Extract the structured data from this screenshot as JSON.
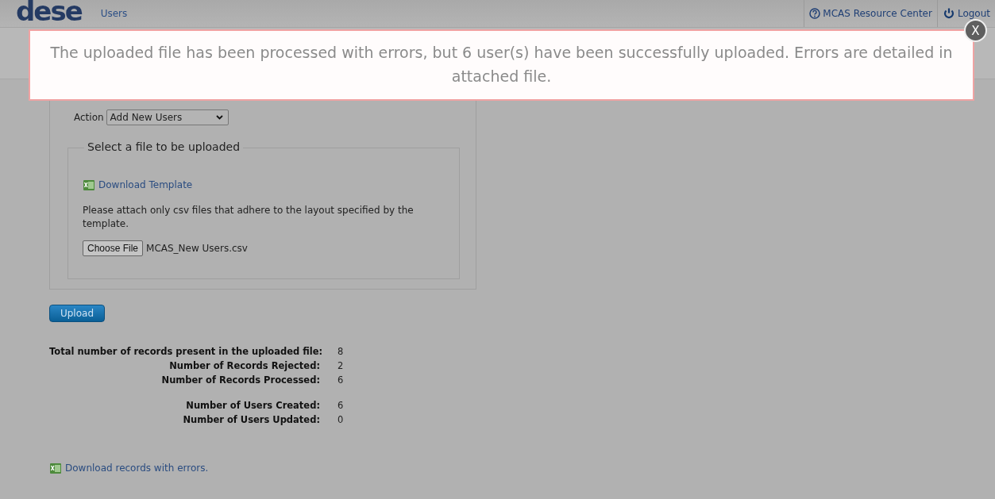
{
  "header": {
    "logo": "dese",
    "section": "Users",
    "links": [
      {
        "kind": "help",
        "label": "MCAS Resource Center"
      },
      {
        "kind": "power",
        "label": "Logout"
      }
    ]
  },
  "alert": {
    "message": "The uploaded file has been processed with errors, but 6 user(s) have been successfully uploaded. Errors are detailed in attached file.",
    "close": "X"
  },
  "form": {
    "action_label": "Action",
    "action_value": "Add New Users",
    "fieldset_legend": "Select a file to be uploaded",
    "template_link": "Download Template",
    "hint": "Please attach only csv files that adhere to the layout specified by the template.",
    "file_button": "Choose File",
    "file_name": "MCAS_New Users.csv"
  },
  "upload_button": "Upload",
  "stat_groups": [
    [
      {
        "label": "Total number of records present in the uploaded file:",
        "value": "8"
      },
      {
        "label": "Number of Records Rejected:",
        "value": "2"
      },
      {
        "label": "Number of Records Processed:",
        "value": "6"
      }
    ],
    [
      {
        "label": "Number of Users Created:",
        "value": "6"
      },
      {
        "label": "Number of Users Updated:",
        "value": "0"
      }
    ]
  ],
  "errors_link": "Download records with errors."
}
